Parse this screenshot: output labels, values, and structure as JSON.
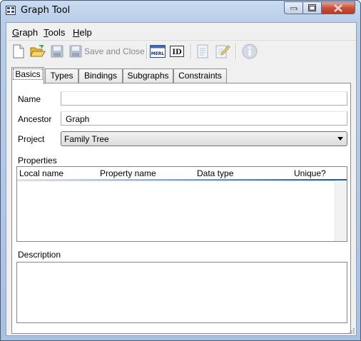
{
  "window": {
    "title": "Graph Tool"
  },
  "menu": [
    {
      "label": "Graph",
      "key": "G"
    },
    {
      "label": "Tools",
      "key": "T"
    },
    {
      "label": "Help",
      "key": "H"
    }
  ],
  "toolbar": {
    "new": "new-document-icon",
    "open": "open-folder-icon",
    "save": "save-icon",
    "save_close_label": "Save and Close",
    "merl": "MERL",
    "id": "ID"
  },
  "tabs": [
    "Basics",
    "Types",
    "Bindings",
    "Subgraphs",
    "Constraints"
  ],
  "form": {
    "name_label": "Name",
    "name_value": "",
    "ancestor_label": "Ancestor",
    "ancestor_value": "Graph",
    "project_label": "Project",
    "project_value": "Family Tree",
    "properties_label": "Properties",
    "columns": [
      "Local name",
      "Property name",
      "Data type",
      "Unique?"
    ],
    "description_label": "Description"
  }
}
